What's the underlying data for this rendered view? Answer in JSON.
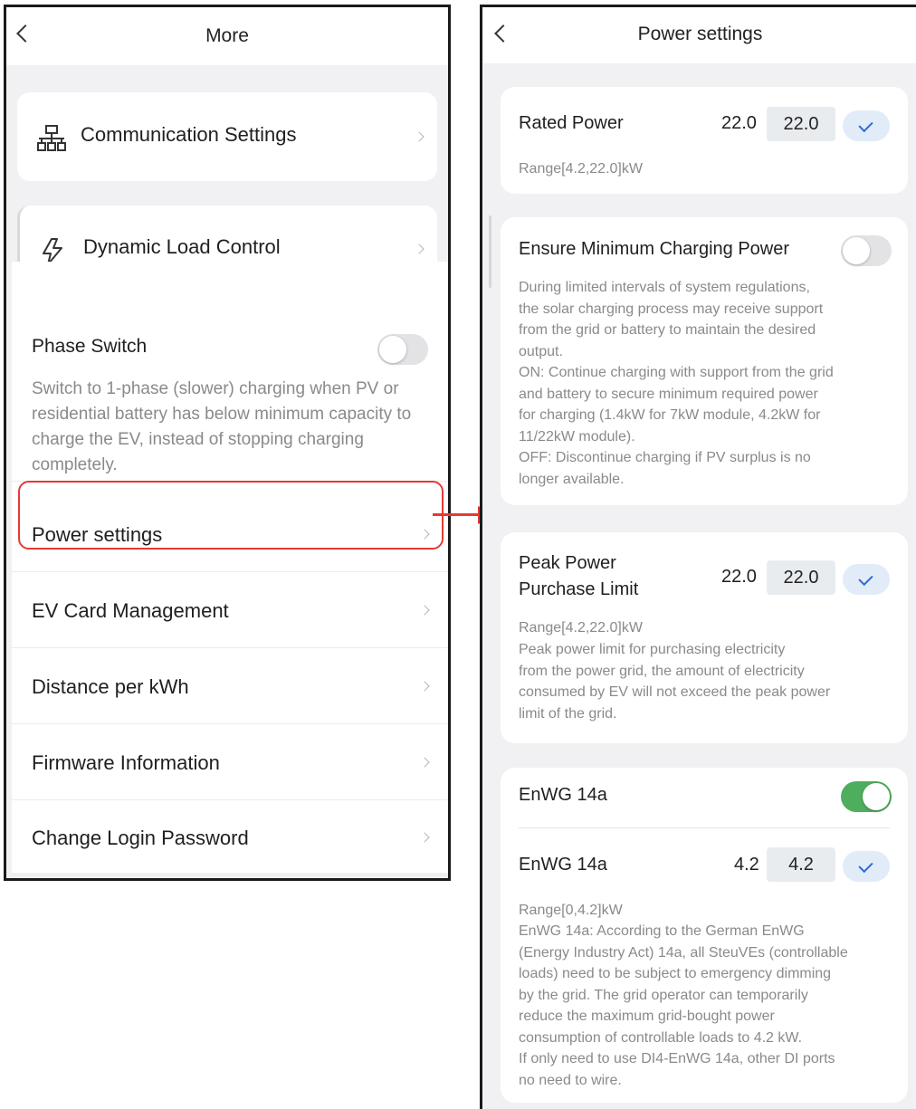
{
  "more": {
    "title": "More",
    "communication_settings": "Communication Settings",
    "dynamic_load_control": "Dynamic Load Control",
    "phase_switch": {
      "label": "Phase Switch",
      "enabled": false,
      "description": "Switch to 1-phase (slower) charging when PV or residential battery has below minimum capacity to charge the EV, instead of stopping charging completely."
    },
    "items": [
      "Power settings",
      "EV Card Management",
      "Distance per kWh",
      "Firmware Information",
      "Change Login Password"
    ]
  },
  "power_settings": {
    "title": "Power settings",
    "rated_power": {
      "label": "Rated Power",
      "value": "22.0",
      "input": "22.0",
      "range": "Range[4.2,22.0]kW"
    },
    "ensure_min": {
      "label": "Ensure Minimum Charging Power",
      "enabled": false,
      "description": [
        "During limited intervals of system regulations,",
        "the solar charging process may receive support",
        "from the grid or battery to maintain the desired",
        "output.",
        "ON: Continue charging with support from the grid",
        "and battery to secure minimum required power",
        "for charging (1.4kW for 7kW module, 4.2kW for",
        "11/22kW module).",
        "OFF:  Discontinue charging if PV surplus is no",
        "longer available."
      ]
    },
    "peak_power": {
      "label_line1": "Peak Power",
      "label_line2": "Purchase Limit",
      "value": "22.0",
      "input": "22.0",
      "range": "Range[4.2,22.0]kW",
      "description": [
        "Peak power limit for purchasing electricity",
        "from the power grid, the amount of electricity",
        "consumed by EV will not exceed the peak power",
        "limit of the grid."
      ]
    },
    "enwg": {
      "toggle_label": "EnWG 14a",
      "enabled": true,
      "label": "EnWG 14a",
      "value": "4.2",
      "input": "4.2",
      "range": "Range[0,4.2]kW",
      "description": [
        "EnWG 14a: According to the German EnWG",
        "(Energy Industry Act) 14a, all SteuVEs (controllable",
        "loads) need to be subject to emergency dimming",
        "by the grid. The grid operator can temporarily",
        "reduce the maximum grid-bought power",
        "consumption of controllable loads to 4.2 kW.",
        "If only need to use DI4-EnWG 14a, other DI ports",
        "no need to wire."
      ]
    }
  },
  "colors": {
    "highlight": "#e53935",
    "toggle_on": "#4fae5e",
    "check_accent": "#2d6ad3"
  }
}
